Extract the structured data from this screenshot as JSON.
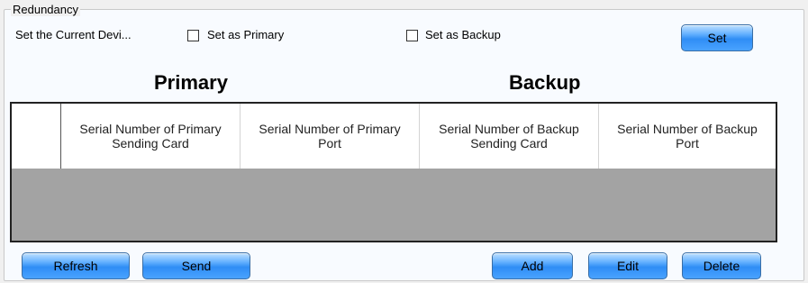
{
  "redundancy": {
    "legend": "Redundancy",
    "device_label": "Set the Current Devi...",
    "primary_checkbox": {
      "label": "Set as Primary",
      "checked": false
    },
    "backup_checkbox": {
      "label": "Set as Backup",
      "checked": false
    },
    "set_button": "Set"
  },
  "headings": {
    "primary": "Primary",
    "backup": "Backup"
  },
  "table": {
    "columns": [
      "",
      "Serial Number of Primary Sending Card",
      "Serial Number of Primary Port",
      "Serial Number of Backup Sending Card",
      "Serial Number of Backup Port"
    ],
    "rows": []
  },
  "buttons": {
    "refresh": "Refresh",
    "send": "Send",
    "add": "Add",
    "edit": "Edit",
    "delete": "Delete"
  },
  "colors": {
    "button_blue": "#2f8df5",
    "table_empty_bg": "#a3a3a3"
  }
}
